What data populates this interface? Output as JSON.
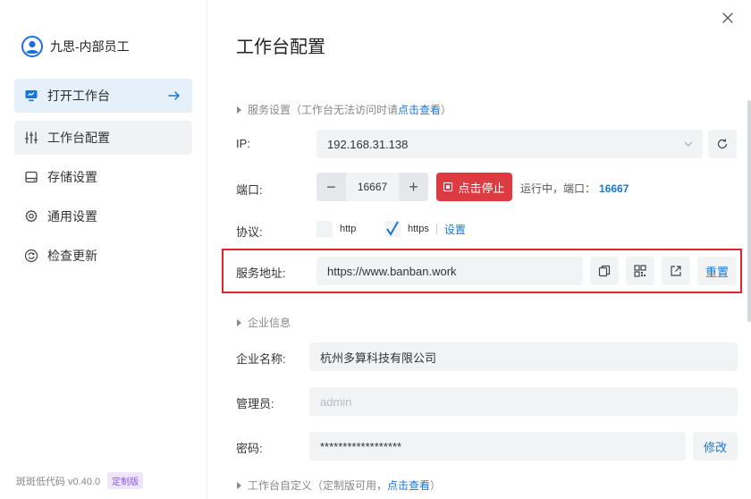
{
  "user": {
    "name": "九思-内部员工"
  },
  "sidebar": {
    "items": [
      {
        "label": "打开工作台"
      },
      {
        "label": "工作台配置"
      },
      {
        "label": "存储设置"
      },
      {
        "label": "通用设置"
      },
      {
        "label": "检查更新"
      }
    ],
    "version": "斑斑低代码 v0.40.0",
    "badge": "定制版"
  },
  "main": {
    "title": "工作台配置",
    "service_section": {
      "label": "服务设置",
      "note_prefix": "（工作台无法访问时请",
      "note_link": "点击查看",
      "note_suffix": "）"
    },
    "ip": {
      "label": "IP:",
      "value": "192.168.31.138"
    },
    "port": {
      "label": "端口:",
      "minus": "−",
      "plus": "+",
      "value": "16667",
      "stop_label": "点击停止",
      "status_text": "运行中，端口：",
      "status_port": "16667"
    },
    "protocol": {
      "label": "协议:",
      "options": [
        {
          "label": "http",
          "checked": false
        },
        {
          "label": "https",
          "checked": true
        }
      ],
      "settings_link": "设置"
    },
    "service_address": {
      "label": "服务地址:",
      "value": "https://www.banban.work",
      "reset_label": "重置"
    },
    "company_section": {
      "label": "企业信息"
    },
    "company_name": {
      "label": "企业名称:",
      "value": "杭州多算科技有限公司"
    },
    "admin": {
      "label": "管理员:",
      "placeholder": "admin"
    },
    "password": {
      "label": "密码:",
      "value": "******************",
      "edit_label": "修改"
    },
    "custom_section": {
      "label": "工作台自定义",
      "note_prefix": "（定制版可用，",
      "note_link": "点击查看",
      "note_suffix": "）"
    }
  },
  "colors": {
    "accent": "#1976d2",
    "active_nav_bg": "#e6f0fb",
    "stop_button": "#dd3b42",
    "highlight_border": "#e1262a",
    "field_bg": "#f2f3f5"
  },
  "icons": {
    "avatar": "user-avatar-icon",
    "open_workbench": "monitor-icon",
    "workbench_config": "sliders-icon",
    "storage": "hard-drive-icon",
    "general": "gear-icon",
    "update": "refresh-circle-icon",
    "arrow": "arrow-right-icon",
    "close": "close-icon",
    "refresh": "refresh-icon",
    "copy": "copy-icon",
    "qrcode": "qrcode-icon",
    "external": "external-link-icon"
  }
}
